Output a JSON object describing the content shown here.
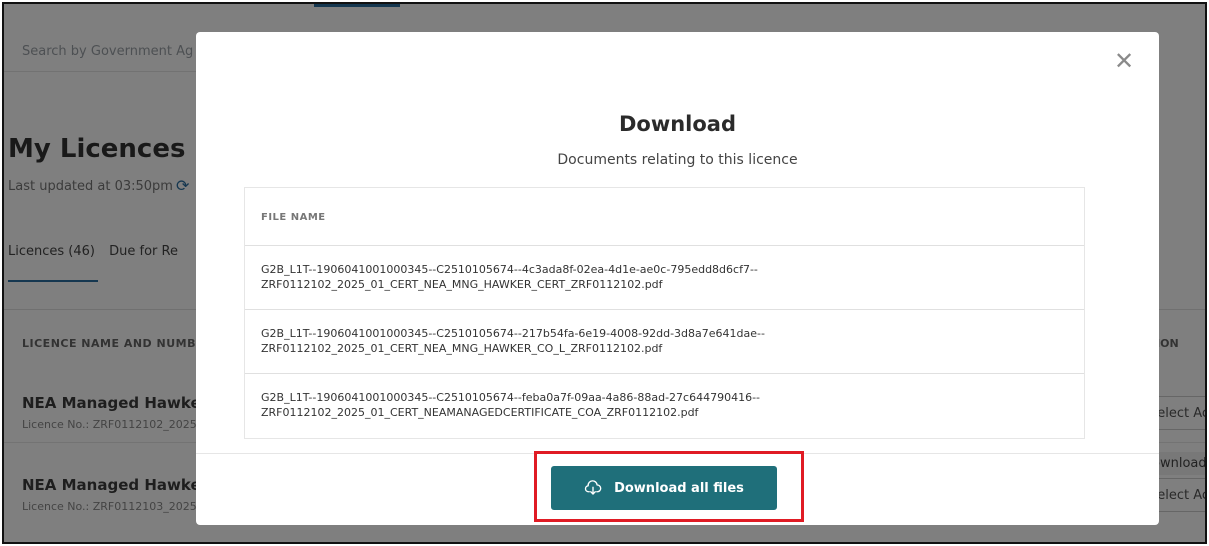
{
  "background": {
    "search_placeholder": "Search by Government Ag",
    "page_title": "My Licences",
    "last_updated": "Last updated at 03:50pm",
    "tabs": [
      "Licences (46)",
      "Due for Re"
    ],
    "column_header": "LICENCE NAME AND NUMBE",
    "action_header": "ACTION",
    "rows": [
      {
        "title": "NEA Managed Hawker",
        "sub": "Licence No.: ZRF0112102_2025",
        "action": "Select Ac"
      },
      {
        "title": "NEA Managed Hawker",
        "sub": "Licence No.: ZRF0112103_2025",
        "action": "Select Ac"
      }
    ],
    "download_label": "Download"
  },
  "modal": {
    "close_icon": "close-icon",
    "title": "Download",
    "subtitle": "Documents relating to this licence",
    "table_header": "FILE NAME",
    "files": [
      {
        "line1": "G2B_L1T--1906041001000345--C2510105674--4c3ada8f-02ea-4d1e-ae0c-795edd8d6cf7--",
        "line2": "ZRF0112102_2025_01_CERT_NEA_MNG_HAWKER_CERT_ZRF0112102.pdf"
      },
      {
        "line1": "G2B_L1T--1906041001000345--C2510105674--217b54fa-6e19-4008-92dd-3d8a7e641dae--",
        "line2": "ZRF0112102_2025_01_CERT_NEA_MNG_HAWKER_CO_L_ZRF0112102.pdf"
      },
      {
        "line1": "G2B_L1T--1906041001000345--C2510105674--feba0a7f-09aa-4a86-88ad-27c644790416--",
        "line2": "ZRF0112102_2025_01_CERT_NEAMANAGEDCERTIFICATE_COA_ZRF0112102.pdf"
      }
    ],
    "download_all_label": "Download all files",
    "download_icon": "cloud-download-icon"
  },
  "colors": {
    "primary": "#1f6f7a",
    "highlight": "#e01b24"
  }
}
